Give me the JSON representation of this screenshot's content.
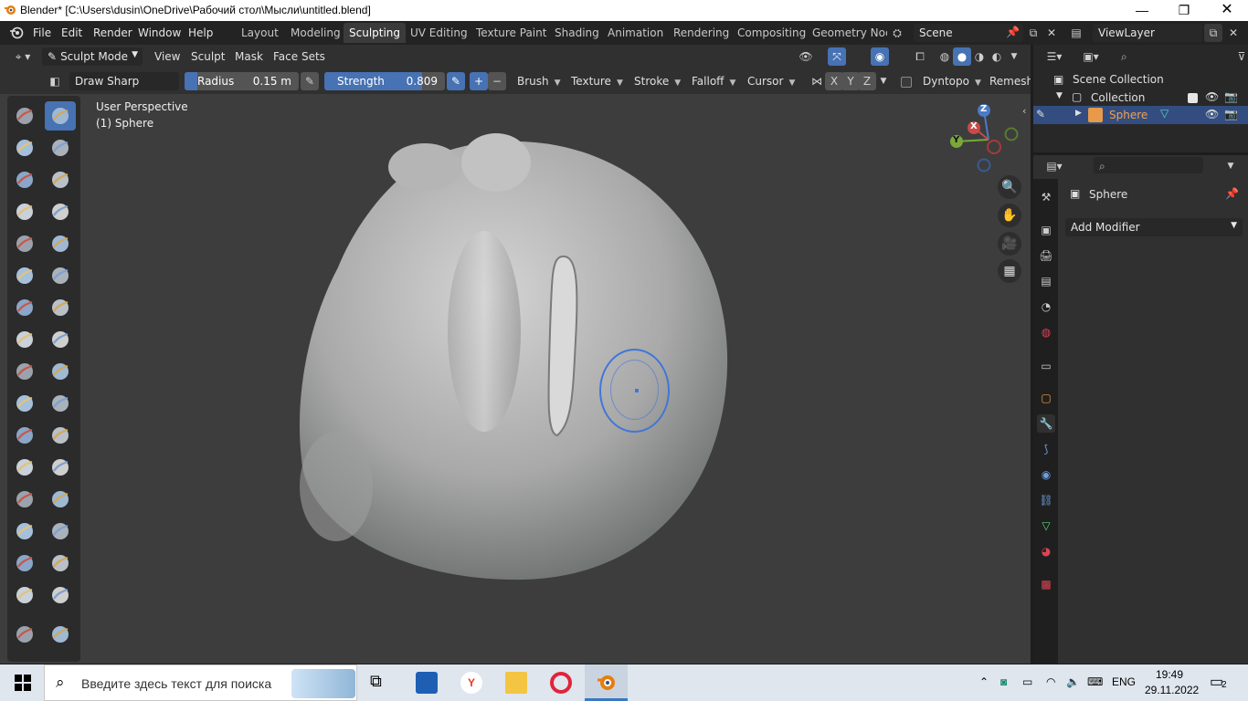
{
  "window": {
    "title": "Blender* [C:\\Users\\dusin\\OneDrive\\Рабочий стол\\Мысли\\untitled.blend]"
  },
  "menu": [
    "File",
    "Edit",
    "Render",
    "Window",
    "Help"
  ],
  "workspaces": [
    "Layout",
    "Modeling",
    "Sculpting",
    "UV Editing",
    "Texture Paint",
    "Shading",
    "Animation",
    "Rendering",
    "Compositing",
    "Geometry Noc"
  ],
  "active_workspace": "Sculpting",
  "scene": "Scene",
  "view_layer": "ViewLayer",
  "header": {
    "mode": "Sculpt Mode",
    "menus": [
      "View",
      "Sculpt",
      "Mask",
      "Face Sets"
    ]
  },
  "tool_settings": {
    "brush_name": "Draw Sharp",
    "radius_label": "Radius",
    "radius_value": "0.15 m",
    "strength_label": "Strength",
    "strength_value": "0.809",
    "strength_fraction": 0.809,
    "dropdowns": [
      "Brush",
      "Texture",
      "Stroke",
      "Falloff",
      "Cursor"
    ],
    "axes": [
      "X",
      "Y",
      "Z"
    ],
    "dyntopo": "Dyntopo",
    "remesh": "Remesh"
  },
  "viewport": {
    "perspective": "User Perspective",
    "object": "(1) Sphere",
    "gizmo": {
      "x": "X",
      "y": "Y",
      "z": "Z"
    }
  },
  "outliner": {
    "scene_collection": "Scene Collection",
    "collection": "Collection",
    "object": "Sphere"
  },
  "properties": {
    "object": "Sphere",
    "add_modifier": "Add Modifier"
  },
  "taskbar": {
    "search_placeholder": "Введите здесь текст для поиска",
    "lang": "ENG",
    "time": "19:49",
    "date": "29.11.2022",
    "notifications": "2"
  },
  "colors": {
    "accent": "#4772b3",
    "active_object": "#f4a24a"
  }
}
